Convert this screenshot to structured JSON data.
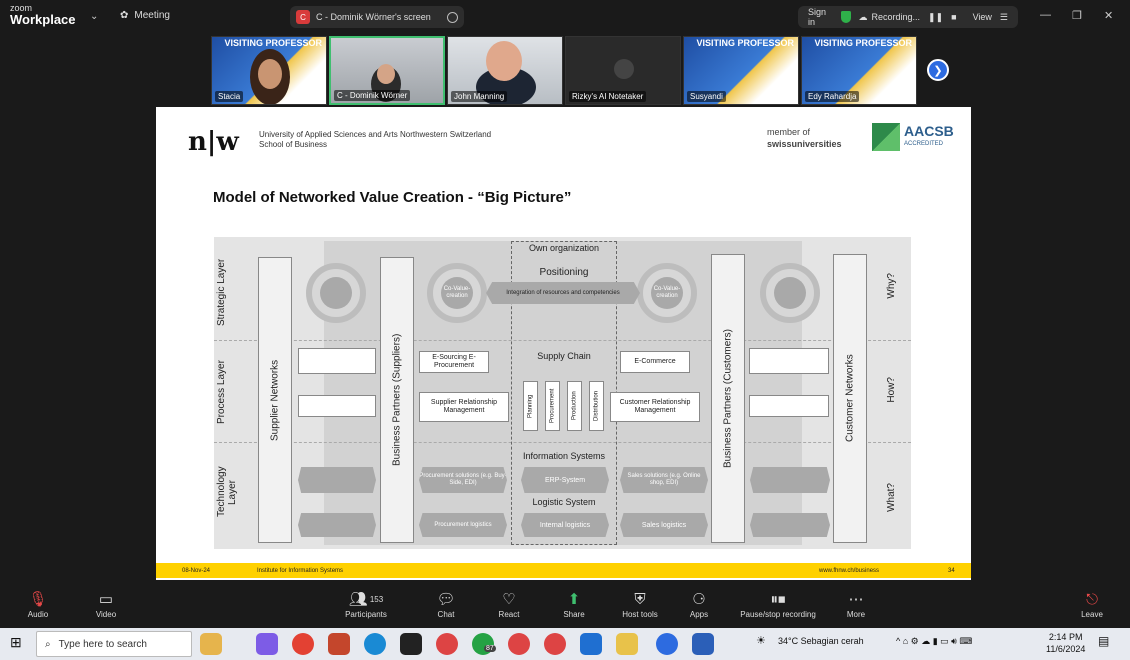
{
  "app": {
    "brand_small": "zoom",
    "brand": "Workplace",
    "meeting_label": "Meeting"
  },
  "share": {
    "label": "C - Dominik Wörner's screen"
  },
  "session": {
    "signin": "Sign in",
    "recording": "Recording...",
    "view": "View"
  },
  "participants": [
    {
      "name": "Stacia"
    },
    {
      "name": "C - Dominik Wörner"
    },
    {
      "name": "John Manning"
    },
    {
      "name": "Rizky's AI Notetaker"
    },
    {
      "name": "Susyandi"
    },
    {
      "name": "Edy Rahardja"
    }
  ],
  "poster_text": "VISITING PROFESSOR",
  "slide": {
    "logo": "n|w",
    "univ1": "University of Applied Sciences and Arts Northwestern Switzerland",
    "univ2": "School of Business",
    "member1": "member of",
    "member2": "swissuniversities",
    "aacsb": "AACSB",
    "aacsb_sub": "ACCREDITED",
    "title": "Model of Networked Value Creation - “Big Picture”",
    "layers": [
      "Strategic Layer",
      "Process Layer",
      "Technology Layer"
    ],
    "questions": [
      "Why?",
      "How?",
      "What?"
    ],
    "columns": [
      "Supplier Networks",
      "Business Partners (Suppliers)",
      "Business Partners (Customers)",
      "Customer Networks"
    ],
    "own_org": "Own organization",
    "positioning": "Positioning",
    "covalue": "Co-Value-creation",
    "integration": "Integration of resources and competencies",
    "supply_chain": "Supply Chain",
    "esourcing": "E-Sourcing E-Procurement",
    "ecommerce": "E-Commerce",
    "srm": "Supplier Relationship Management",
    "crm": "Customer Relationship Management",
    "chain": [
      "Planning",
      "Procurement",
      "Production",
      "Distribution"
    ],
    "info_systems": "Information Systems",
    "proc_solutions": "Procurement solutions (e.g. Buy-Side, EDI)",
    "erp": "ERP-System",
    "sales_solutions": "Sales solutions (e.g. Online shop, EDI)",
    "logistic_system": "Logistic System",
    "proc_logistics": "Procurement logistics",
    "internal_logistics": "Internal logistics",
    "sales_logistics": "Sales logistics",
    "footer_date": "08-Nov-24",
    "footer_inst": "Institute for Information Systems",
    "footer_url": "www.fhnw.ch/business",
    "page": "34"
  },
  "toolbar": {
    "audio": "Audio",
    "video": "Video",
    "participants": "Participants",
    "participants_count": "153",
    "chat": "Chat",
    "react": "React",
    "share": "Share",
    "host_tools": "Host tools",
    "apps": "Apps",
    "pause": "Pause/stop recording",
    "more": "More",
    "leave": "Leave"
  },
  "taskbar": {
    "search": "Type here to search",
    "weather": "34°C  Sebagian cerah",
    "time": "2:14 PM",
    "date": "11/6/2024",
    "whatsapp_badge": "87"
  }
}
